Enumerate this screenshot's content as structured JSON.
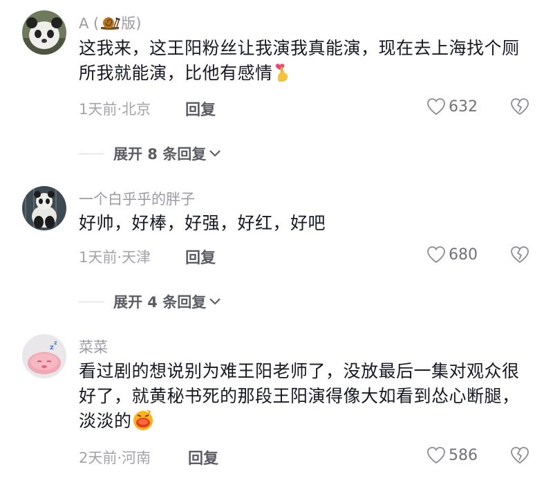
{
  "comments": [
    {
      "username": "A (",
      "username_badge": "snail-icon",
      "username_suffix": "版)",
      "text": "这我来，这王阳粉丝让我演我真能演，现在去上海找个厕所我就能演，比他有感情",
      "text_emoji": "finger-heart-emoji",
      "time_location": "1天前·北京",
      "reply_label": "回复",
      "likes": "632",
      "expand_label": "展开 8 条回复"
    },
    {
      "username": "一个白乎乎的胖子",
      "text": "好帅，好棒，好强，好红，好吧",
      "time_location": "1天前·天津",
      "reply_label": "回复",
      "likes": "680",
      "expand_label": "展开 4 条回复"
    },
    {
      "username": "菜菜",
      "text": "看过剧的想说别为难王阳老师了，没放最后一集对观众很好了，就黄秘书死的那段王阳演得像大如看到怂心断腿，淡淡的",
      "text_emoji": "face-emoji",
      "time_location": "2天前·河南",
      "reply_label": "回复",
      "likes": "586"
    }
  ],
  "colors": {
    "text": "#161823",
    "meta": "#a3a3aa",
    "username": "#9a9aa3"
  }
}
